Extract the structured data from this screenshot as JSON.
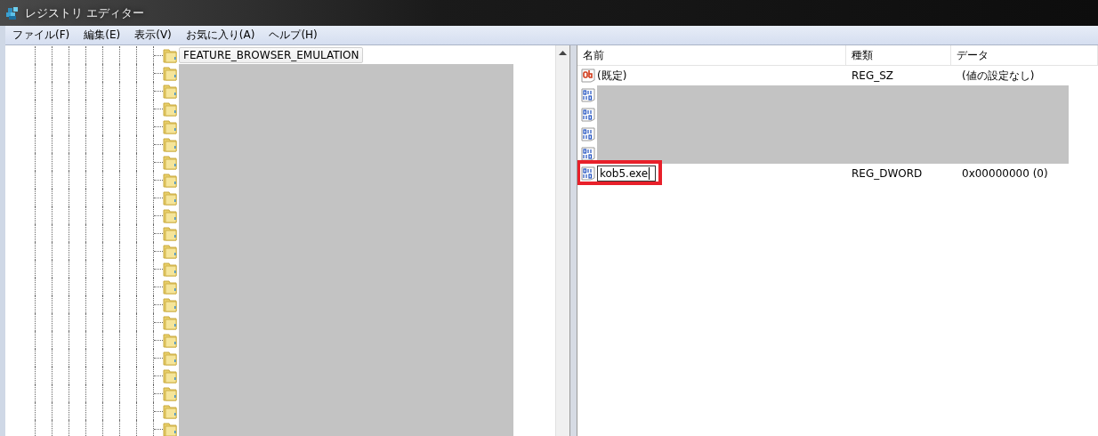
{
  "window": {
    "title": "レジストリ エディター"
  },
  "menu": [
    {
      "label": "ファイル(F)"
    },
    {
      "label": "編集(E)"
    },
    {
      "label": "表示(V)"
    },
    {
      "label": "お気に入り(A)"
    },
    {
      "label": "ヘルプ(H)"
    }
  ],
  "tree": {
    "items": [
      {
        "kind": "key",
        "label": "FEATURE_BROWSER_EMULATION",
        "selected": true
      },
      {
        "kind": "redacted"
      },
      {
        "kind": "redacted"
      },
      {
        "kind": "redacted"
      },
      {
        "kind": "redacted"
      },
      {
        "kind": "redacted"
      },
      {
        "kind": "redacted"
      },
      {
        "kind": "redacted"
      },
      {
        "kind": "redacted"
      },
      {
        "kind": "redacted"
      },
      {
        "kind": "redacted"
      },
      {
        "kind": "redacted"
      },
      {
        "kind": "redacted"
      },
      {
        "kind": "redacted"
      },
      {
        "kind": "redacted"
      },
      {
        "kind": "redacted"
      },
      {
        "kind": "redacted"
      },
      {
        "kind": "redacted"
      },
      {
        "kind": "redacted"
      },
      {
        "kind": "redacted"
      },
      {
        "kind": "redacted"
      },
      {
        "kind": "redacted"
      }
    ]
  },
  "values": {
    "columns": [
      "名前",
      "種類",
      "データ"
    ],
    "rows": [
      {
        "kind": "string",
        "name": "(既定)",
        "type": "REG_SZ",
        "data": "(値の設定なし)"
      },
      {
        "kind": "redacted"
      },
      {
        "kind": "redacted"
      },
      {
        "kind": "redacted"
      },
      {
        "kind": "redacted"
      },
      {
        "kind": "binary",
        "name": "kob5.exe",
        "type": "REG_DWORD",
        "data": "0x00000000 (0)",
        "editing": true,
        "highlighted": true
      }
    ]
  }
}
